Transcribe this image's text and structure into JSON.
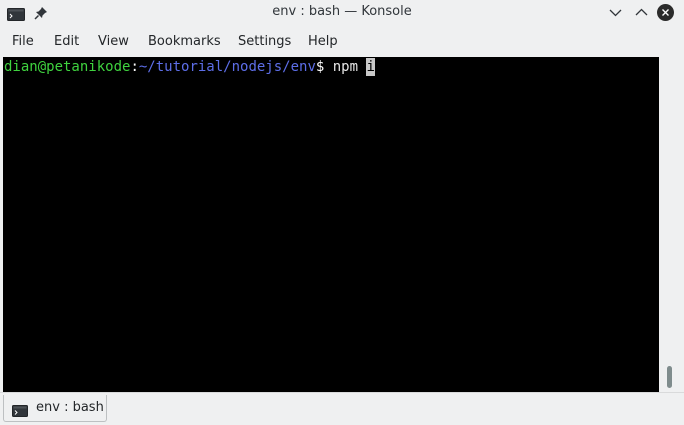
{
  "window": {
    "title": "env : bash — Konsole",
    "app_icon": "konsole-terminal-icon",
    "buttons": {
      "pin": "pin-icon",
      "minimize": "chevron-down-icon",
      "maximize": "chevron-up-icon",
      "close": "close-icon"
    }
  },
  "menu": {
    "items": [
      "File",
      "Edit",
      "View",
      "Bookmarks",
      "Settings",
      "Help"
    ]
  },
  "terminal": {
    "prompt_user_host": "dian@petanikode",
    "prompt_colon": ":",
    "prompt_path": "~/tutorial/nodejs/env",
    "prompt_symbol": "$",
    "command_text": " npm ",
    "cursor_char": "i"
  },
  "tabs": [
    {
      "label": "env : bash",
      "icon": "terminal-icon"
    }
  ],
  "colors": {
    "background": "#eff0f1",
    "terminal_bg": "#000000",
    "prompt_user": "#3fd23f",
    "prompt_path": "#5d6ee8",
    "terminal_text": "#e6e6e6",
    "close_button": "#2b2b2b"
  }
}
